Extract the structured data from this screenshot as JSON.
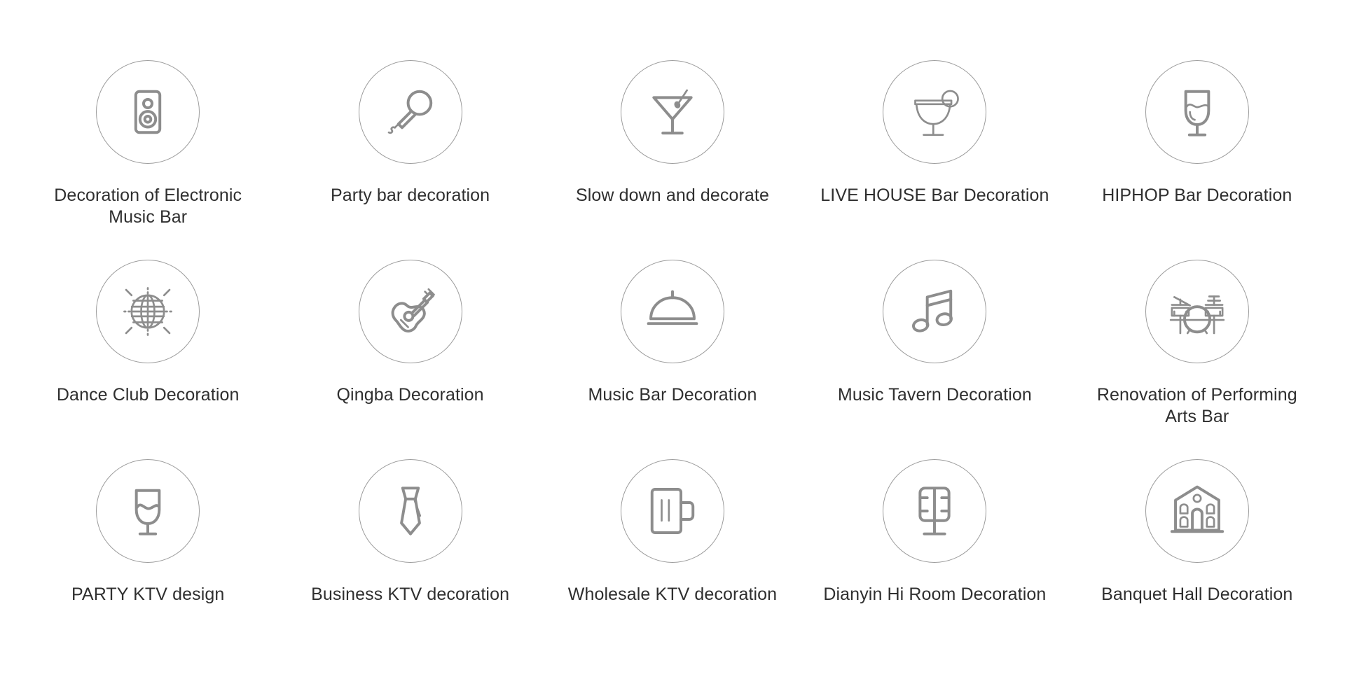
{
  "page": {
    "title": "Bar and KTV Decoration Categories",
    "background_color": "#ffffff",
    "circle_border_color": "#9c9c9c",
    "icon_color": "#8d8d8d",
    "label_color": "#2f2f2f"
  },
  "grid": {
    "columns": 5,
    "rows": 3,
    "items": [
      {
        "label": "Decoration of Electronic Music Bar",
        "icon": "speaker-icon"
      },
      {
        "label": "Party bar decoration",
        "icon": "microphone-icon"
      },
      {
        "label": "Slow down and decorate",
        "icon": "martini-glass-icon"
      },
      {
        "label": "LIVE HOUSE Bar Decoration",
        "icon": "margarita-glass-icon"
      },
      {
        "label": "HIPHOP Bar Decoration",
        "icon": "wine-glass-icon"
      },
      {
        "label": "Dance Club Decoration",
        "icon": "disco-ball-icon"
      },
      {
        "label": "Qingba Decoration",
        "icon": "acoustic-guitar-icon"
      },
      {
        "label": "Music Bar Decoration",
        "icon": "serving-cloche-icon"
      },
      {
        "label": "Music Tavern Decoration",
        "icon": "music-note-icon"
      },
      {
        "label": "Renovation of Performing Arts Bar",
        "icon": "drum-kit-icon"
      },
      {
        "label": "PARTY KTV design",
        "icon": "wine-glass-wave-icon"
      },
      {
        "label": "Business KTV decoration",
        "icon": "necktie-icon"
      },
      {
        "label": "Wholesale KTV decoration",
        "icon": "beer-mug-icon"
      },
      {
        "label": "Dianyin Hi Room Decoration",
        "icon": "studio-microphone-icon"
      },
      {
        "label": "Banquet Hall Decoration",
        "icon": "banquet-hall-building-icon"
      }
    ]
  }
}
